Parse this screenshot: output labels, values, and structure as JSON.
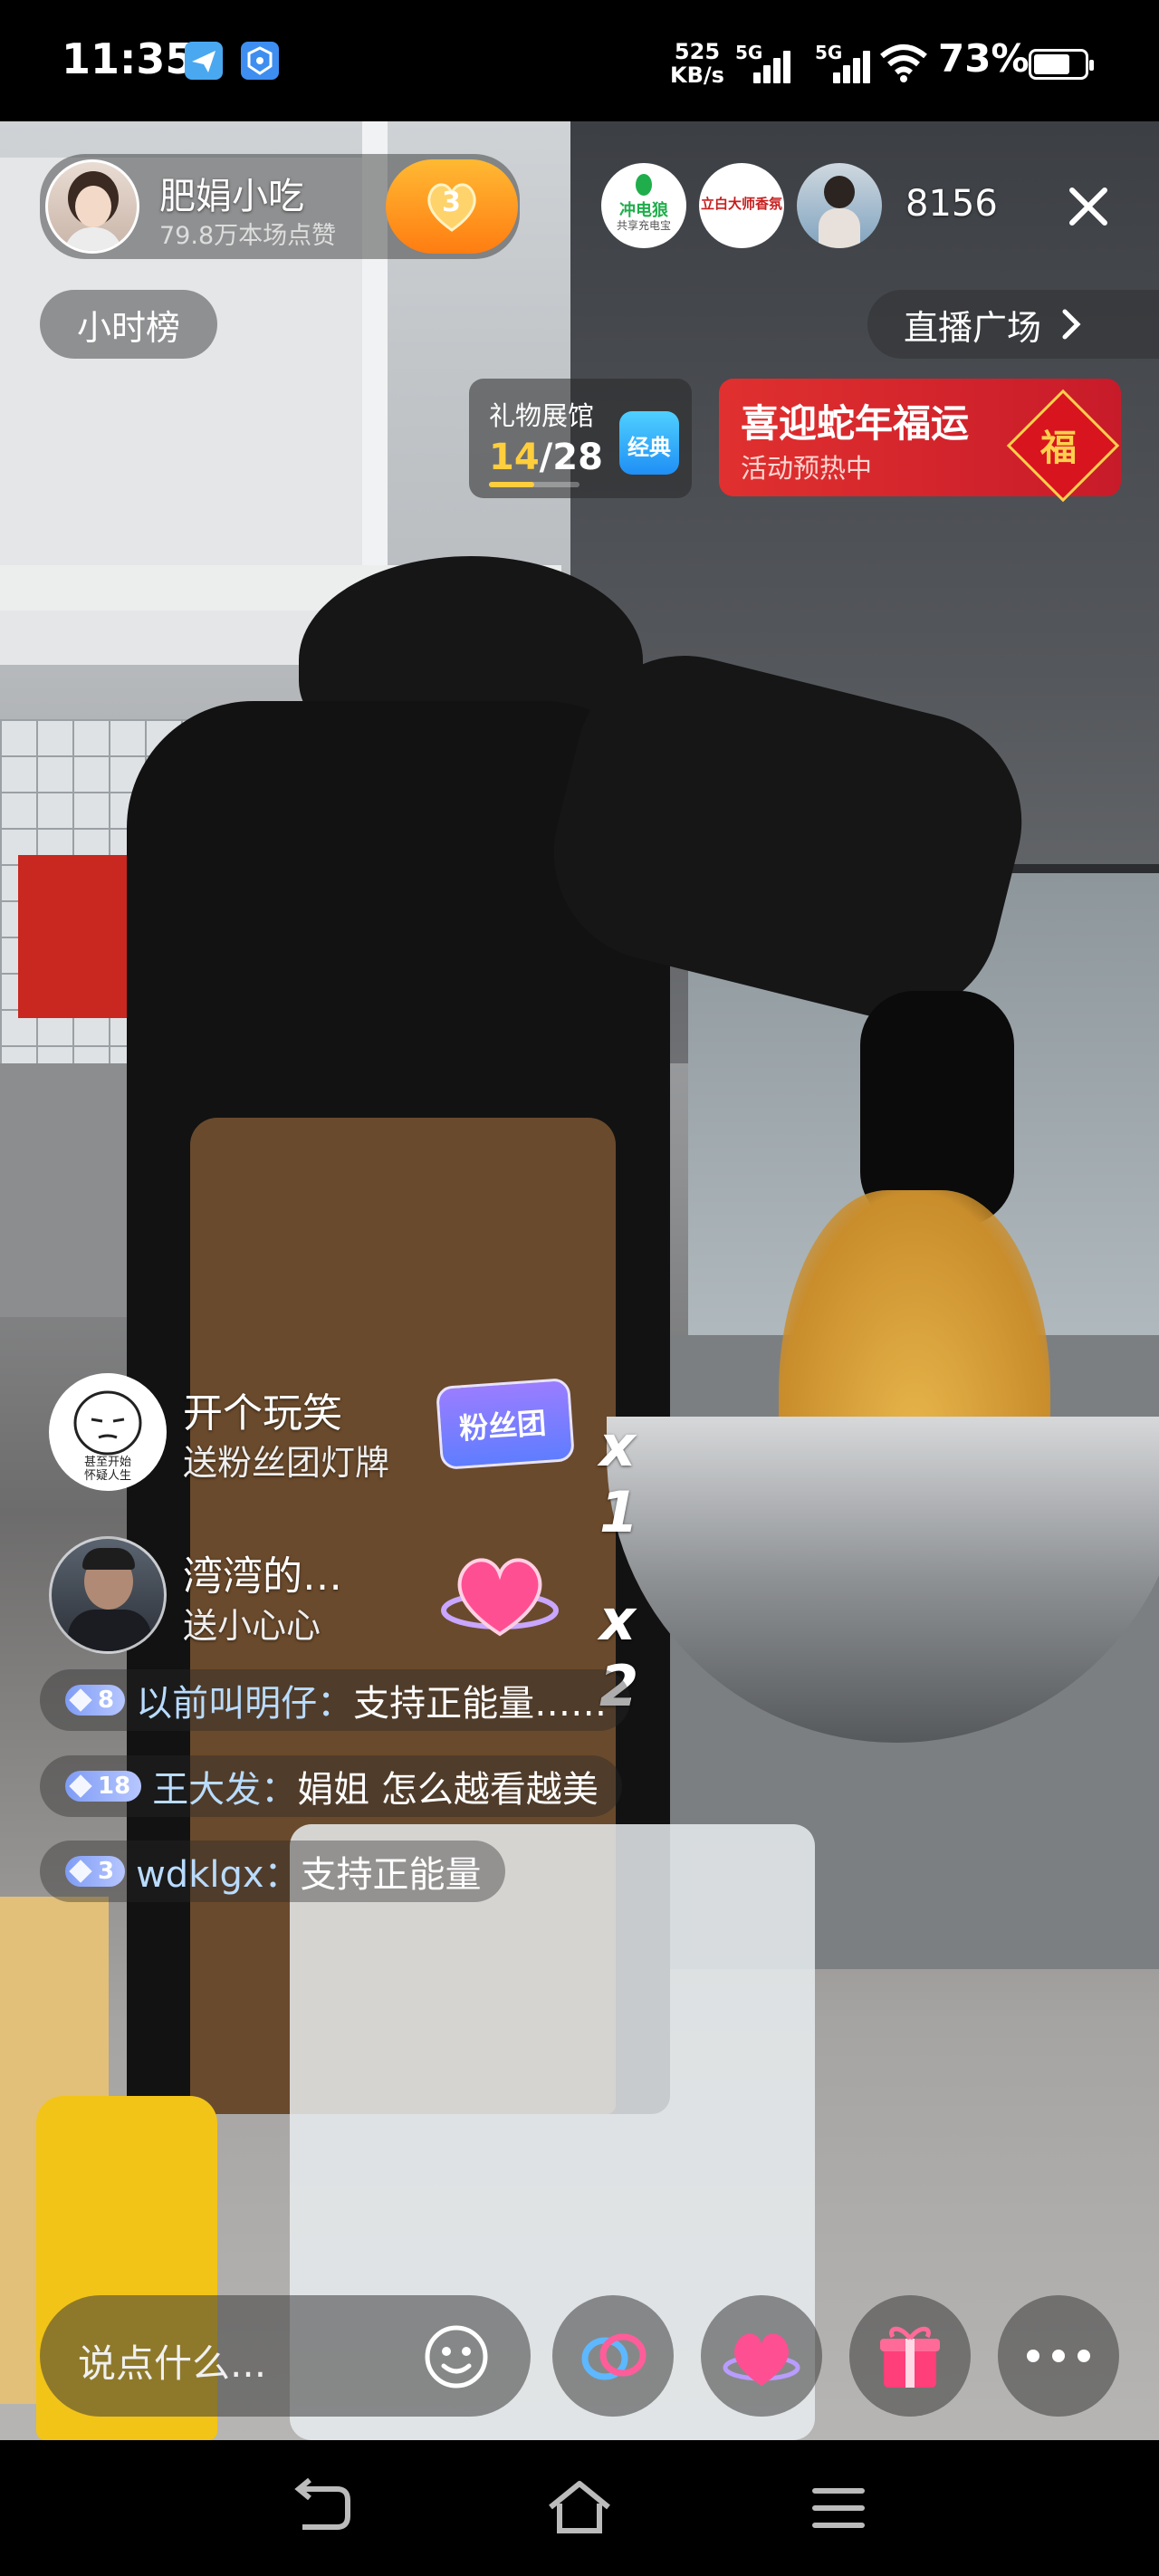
{
  "status_bar": {
    "time": "11:35",
    "net_speed_value": "525",
    "net_speed_unit": "KB/s",
    "sim1_label": "5G",
    "sim2_label": "5G",
    "battery_pct": "73%",
    "battery_level": 0.73,
    "app_icons": [
      "paper-plane-icon",
      "shield-app-icon"
    ]
  },
  "streamer": {
    "name": "肥娟小吃",
    "likes": "79.8万本场点赞",
    "fan_badge_level": "3"
  },
  "top_right": {
    "viewer_sponsors": [
      "冲电狼",
      "立白大师香氛"
    ],
    "sponsor1_sub": "共享充电宝",
    "viewer_count": "8156"
  },
  "hour_rank_label": "小时榜",
  "live_plaza_label": "直播广场",
  "gift_hall": {
    "title": "礼物展馆",
    "progress_current": "14",
    "progress_total": "/28",
    "progress_fraction": 0.5,
    "badge": "经典"
  },
  "festival_banner": {
    "title": "喜迎蛇年福运",
    "subtitle": "活动预热中",
    "fu_char": "福"
  },
  "gift_events": [
    {
      "user": "开个玩笑",
      "action": "送粉丝团灯牌",
      "gift_icon": "fan-club-sign-icon",
      "gift_label": "粉丝团",
      "count": "x 1",
      "avatar_caption_1": "甚至开始",
      "avatar_caption_2": "怀疑人生"
    },
    {
      "user": "湾湾的…",
      "action": "送小心心",
      "gift_icon": "heart-gift-icon",
      "count": "x 2"
    }
  ],
  "chat_messages": [
    {
      "level": "8",
      "user": "以前叫明仔：",
      "text": "支持正能量……"
    },
    {
      "level": "18",
      "user": "王大发：",
      "text": "娟姐 怎么越看越美"
    },
    {
      "level": "3",
      "user": "wdklgx：",
      "text": "支持正能量"
    }
  ],
  "bottom_bar": {
    "comment_placeholder": "说点什么...",
    "buttons": [
      "emoji-icon",
      "link-mic-icon",
      "heart-gift-icon",
      "gift-box-icon",
      "more-icon"
    ]
  },
  "nav_bar": {
    "buttons": [
      "back-icon",
      "home-icon",
      "recents-icon"
    ]
  }
}
